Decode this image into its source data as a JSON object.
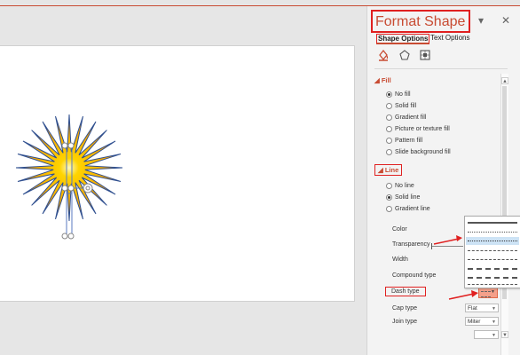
{
  "pane": {
    "title": "Format Shape",
    "minimize": "▾",
    "close": "✕",
    "tabs": [
      {
        "label": "Shape Options",
        "active": true
      },
      {
        "label": "Text Options",
        "active": false
      }
    ],
    "category_icons": [
      "fill-line-icon",
      "effects-icon",
      "size-properties-icon"
    ]
  },
  "fill": {
    "header": "◢ Fill",
    "options": [
      {
        "label": "No fill",
        "checked": true
      },
      {
        "label": "Solid fill",
        "checked": false
      },
      {
        "label": "Gradient fill",
        "checked": false
      },
      {
        "label": "Picture or texture fill",
        "checked": false
      },
      {
        "label": "Pattern fill",
        "checked": false
      },
      {
        "label": "Slide background fill",
        "checked": false
      }
    ]
  },
  "line": {
    "header": "◢ Line",
    "options": [
      {
        "label": "No line",
        "checked": false
      },
      {
        "label": "Solid line",
        "checked": true
      },
      {
        "label": "Gradient line",
        "checked": false
      }
    ],
    "properties": {
      "color": "Color",
      "transparency": "Transparency",
      "width": "Width",
      "compound_type": "Compound type",
      "dash_type": "Dash type",
      "cap_type": "Cap type",
      "join_type": "Join type"
    },
    "cap_value": "Flat",
    "join_value": "Miter"
  },
  "colors": {
    "accent": "#c84b32",
    "highlight": "#e02020",
    "sun_center": "#ffd400",
    "sun_edge": "#f08a00",
    "sun_stroke": "#2f4f8f"
  }
}
